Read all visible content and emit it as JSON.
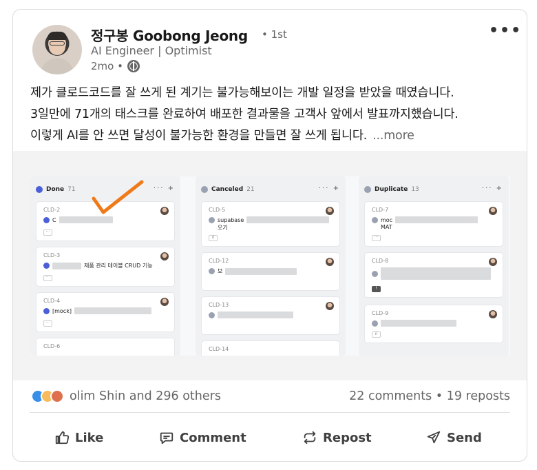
{
  "post": {
    "author": {
      "name": "정구봉 Goobong Jeong",
      "degree": "• 1st",
      "headline": "AI Engineer | Optimist",
      "time": "2mo •"
    },
    "text": [
      "제가 클로드코드를 잘 쓰게 된 계기는 불가능해보이는 개발 일정을 받았을 때였습니다.",
      "3일만에 71개의 태스크를 완료하여 배포한 결과물을 고객사 앞에서 발표까지했습니다.",
      "이렇게 AI를 안 쓰면 달성이 불가능한 환경을 만들면 잘 쓰게 됩니다."
    ],
    "see_more": "...more",
    "board": {
      "columns": [
        {
          "title": "Done",
          "count": "71",
          "status": "done",
          "tasks": [
            {
              "id": "CLD-2",
              "text": "C",
              "text2": ""
            },
            {
              "id": "CLD-3",
              "text": "제품 관리 테이블 CRUD 기능",
              "text2": ""
            },
            {
              "id": "CLD-4",
              "text": "[mock]",
              "text2": ""
            },
            {
              "id": "CLD-6",
              "text": "",
              "text2": ""
            }
          ]
        },
        {
          "title": "Canceled",
          "count": "21",
          "status": "canceled",
          "tasks": [
            {
              "id": "CLD-5",
              "text": "supabase",
              "text2": "오기"
            },
            {
              "id": "CLD-12",
              "text": "보",
              "text2": ""
            },
            {
              "id": "CLD-13",
              "text": "",
              "text2": ""
            },
            {
              "id": "CLD-14",
              "text": "",
              "text2": ""
            }
          ]
        },
        {
          "title": "Duplicate",
          "count": "13",
          "status": "duplicate",
          "tasks": [
            {
              "id": "CLD-7",
              "text": "moc",
              "text2": "MAT"
            },
            {
              "id": "CLD-8",
              "text": "",
              "text2": ""
            },
            {
              "id": "CLD-9",
              "text": "",
              "text2": ""
            }
          ]
        }
      ],
      "column_actions": "··· +"
    },
    "social": {
      "reaction_icons": [
        "like-icon",
        "insightful-icon",
        "love-icon"
      ],
      "reactions_text": "olim Shin and 296 others",
      "comments_reposts": "22 comments • 19 reposts"
    },
    "actions": {
      "like": "Like",
      "comment": "Comment",
      "repost": "Repost",
      "send": "Send"
    }
  }
}
